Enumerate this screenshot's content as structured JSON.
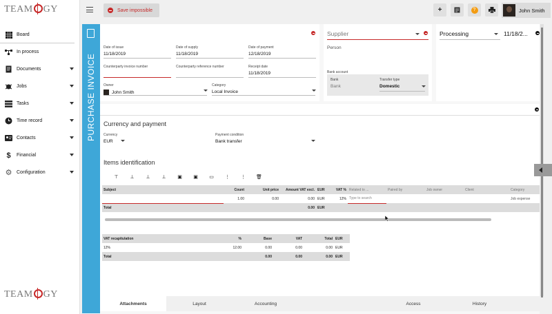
{
  "app": {
    "logo_text": "TEAMOGY"
  },
  "sidebar": {
    "items": [
      {
        "label": "Board",
        "icon": "grid-icon"
      },
      {
        "label": "In process",
        "icon": "workflow-icon"
      },
      {
        "label": "Documents",
        "icon": "document-icon"
      },
      {
        "label": "Jobs",
        "icon": "bug-icon"
      },
      {
        "label": "Tasks",
        "icon": "tasks-icon"
      },
      {
        "label": "Time record",
        "icon": "clock-icon"
      },
      {
        "label": "Contacts",
        "icon": "contact-card-icon"
      },
      {
        "label": "Financial",
        "icon": "dollar-icon"
      },
      {
        "label": "Configuration",
        "icon": "gear-icon"
      }
    ]
  },
  "toolbar": {
    "save_label": "Save impossible",
    "user_name": "John Smith"
  },
  "invoice": {
    "vertical_title": "PURCHASE INVOICE",
    "date_of_issue_label": "Date of issue",
    "date_of_issue": "11/18/2019",
    "date_of_supply_label": "Date of supply",
    "date_of_supply": "11/18/2019",
    "date_of_payment_label": "Date of payment",
    "date_of_payment": "12/18/2019",
    "counterparty_invoice_label": "Counterparty invoice number",
    "counterparty_reference_label": "Counterparty reference number",
    "receipt_date_label": "Receipt date",
    "receipt_date": "11/18/2019",
    "owner_label": "Owner",
    "owner": "John Smith",
    "category_label": "Category",
    "category": "Local Invoice"
  },
  "supplier": {
    "placeholder": "Supplier",
    "person": "Person",
    "bank_account_label": "Bank account",
    "bank_label": "Bank",
    "bank_value": "Bank",
    "transfer_type_label": "Transfer type",
    "transfer_type": "Domestic"
  },
  "status": {
    "value": "Processing",
    "date": "11/18/2..."
  },
  "currency": {
    "heading": "Currency and payment",
    "currency_label": "Currency",
    "currency": "EUR",
    "payment_condition_label": "Payment condition",
    "payment_condition": "Bank transfer"
  },
  "items": {
    "heading": "Items identification",
    "columns": [
      "Subject",
      "Count",
      "Unit price",
      "Amount VAT excl.",
      "EUR",
      "VAT %",
      "Related to ...",
      "Paired by",
      "Job owner",
      "Client",
      "Category"
    ],
    "row": {
      "subject": "",
      "count": "1.00",
      "unit_price": "0.00",
      "amount": "0.00",
      "cur": "EUR",
      "vat": "12%",
      "related_placeholder": "Type to search",
      "category": "Job expense"
    },
    "total_label": "Total",
    "total_amount": "0.00",
    "total_cur": "EUR"
  },
  "vat": {
    "columns": [
      "VAT recapitulation",
      "%",
      "Base",
      "VAT",
      "Total",
      "EUR"
    ],
    "rows": [
      {
        "name": "12%",
        "pct": "12.00",
        "base": "0.00",
        "vat": "0.00",
        "total": "0.00",
        "cur": "EUR"
      }
    ],
    "total": {
      "name": "Total",
      "base": "0.00",
      "vat": "0.00",
      "total": "0.00",
      "cur": "EUR"
    }
  },
  "tabs": [
    "Attachments",
    "Layout",
    "Accounting",
    "Access",
    "History"
  ]
}
